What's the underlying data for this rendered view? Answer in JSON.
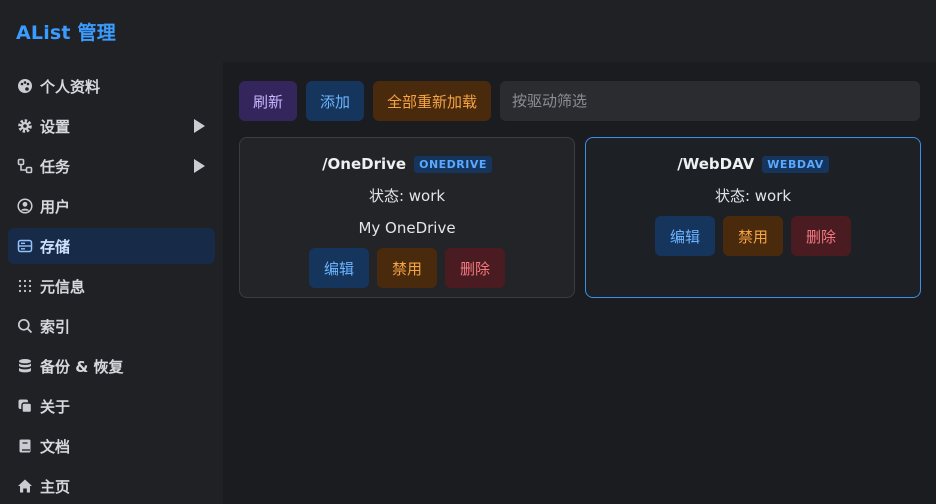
{
  "app": {
    "title": "AList 管理"
  },
  "sidebar": {
    "items": [
      {
        "label": "个人资料",
        "icon": "palette-icon"
      },
      {
        "label": "设置",
        "icon": "gear-icon",
        "expandable": true
      },
      {
        "label": "任务",
        "icon": "flow-icon",
        "expandable": true
      },
      {
        "label": "用户",
        "icon": "user-circle-icon"
      },
      {
        "label": "存储",
        "icon": "storage-icon",
        "active": true
      },
      {
        "label": "元信息",
        "icon": "dots-grid-icon"
      },
      {
        "label": "索引",
        "icon": "search-icon"
      },
      {
        "label": "备份 & 恢复",
        "icon": "database-icon"
      },
      {
        "label": "关于",
        "icon": "copy-icon"
      },
      {
        "label": "文档",
        "icon": "book-icon"
      },
      {
        "label": "主页",
        "icon": "home-icon"
      }
    ]
  },
  "toolbar": {
    "refresh_label": "刷新",
    "add_label": "添加",
    "reload_all_label": "全部重新加载",
    "filter_placeholder": "按驱动筛选"
  },
  "storages": [
    {
      "mount_path": "/OneDrive",
      "driver": "ONEDRIVE",
      "status": "状态: work",
      "remark": "My OneDrive",
      "edit_label": "编辑",
      "disable_label": "禁用",
      "delete_label": "删除"
    },
    {
      "mount_path": "/WebDAV",
      "driver": "WEBDAV",
      "status": "状态: work",
      "edit_label": "编辑",
      "disable_label": "禁用",
      "delete_label": "删除"
    }
  ],
  "colors": {
    "accent": "#3b9cff",
    "active_bg": "#172a47"
  }
}
